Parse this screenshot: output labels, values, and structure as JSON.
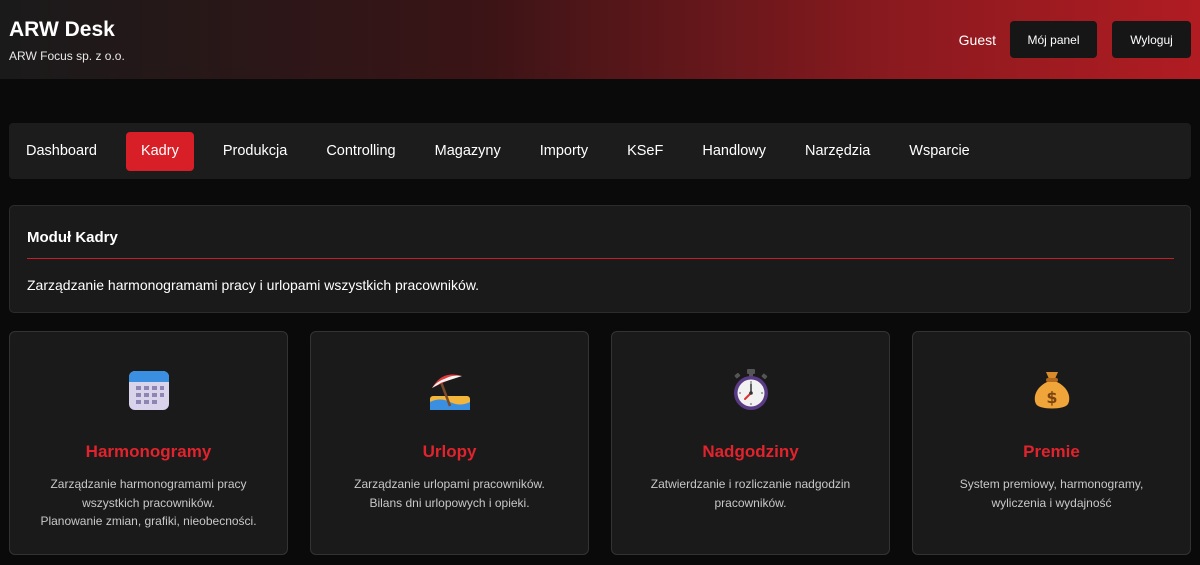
{
  "header": {
    "title": "ARW Desk",
    "subtitle": "ARW Focus sp. z o.o.",
    "user": "Guest",
    "panel_button": "Mój panel",
    "logout_button": "Wyloguj"
  },
  "nav": {
    "items": [
      "Dashboard",
      "Kadry",
      "Produkcja",
      "Controlling",
      "Magazyny",
      "Importy",
      "KSeF",
      "Handlowy",
      "Narzędzia",
      "Wsparcie"
    ],
    "active": "Kadry"
  },
  "module": {
    "title": "Moduł Kadry",
    "description": "Zarządzanie harmonogramami pracy i urlopami wszystkich pracowników."
  },
  "cards": [
    {
      "icon": "calendar-icon",
      "title": "Harmonogramy",
      "lines": [
        "Zarządzanie harmonogramami pracy",
        "wszystkich pracowników.",
        "Planowanie zmian, grafiki, nieobecności."
      ]
    },
    {
      "icon": "beach-umbrella-icon",
      "title": "Urlopy",
      "lines": [
        "Zarządzanie urlopami pracowników.",
        "Bilans dni urlopowych i opieki."
      ]
    },
    {
      "icon": "stopwatch-icon",
      "title": "Nadgodziny",
      "lines": [
        "Zatwierdzanie i rozliczanie nadgodzin",
        "pracowników."
      ]
    },
    {
      "icon": "money-bag-icon",
      "title": "Premie",
      "lines": [
        "System premiowy, harmonogramy,",
        "wyliczenia i wydajność"
      ]
    }
  ],
  "colors": {
    "accent": "#d81e26",
    "card_title": "#e0232c",
    "background": "#0a0a0a"
  }
}
